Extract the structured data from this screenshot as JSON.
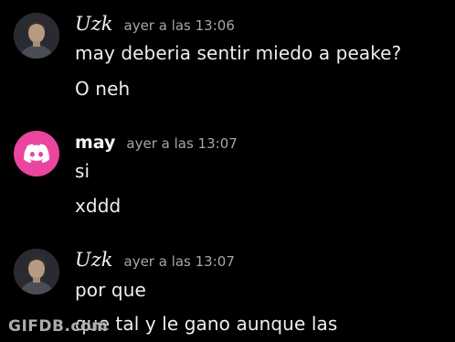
{
  "messages": [
    {
      "author": "Uzk",
      "avatar": "user-photo-avatar",
      "timestamp": "ayer a las 13:06",
      "lines": [
        "may deberia sentir miedo a peake?",
        "O neh"
      ]
    },
    {
      "author": "may",
      "avatar": "discord-logo-avatar",
      "avatar_color": "#eb459f",
      "timestamp": "ayer a las 13:07",
      "lines": [
        "si",
        "xddd"
      ]
    },
    {
      "author": "Uzk",
      "avatar": "user-photo-avatar",
      "timestamp": "ayer a las 13:07",
      "lines": [
        "por que",
        "que tal y le gano aunque las"
      ]
    }
  ],
  "watermark": "GIFDB.com",
  "colors": {
    "background": "#000000",
    "username": "#f2f3f5",
    "timestamp": "#a3a6ad",
    "message_text": "#eceef0"
  }
}
